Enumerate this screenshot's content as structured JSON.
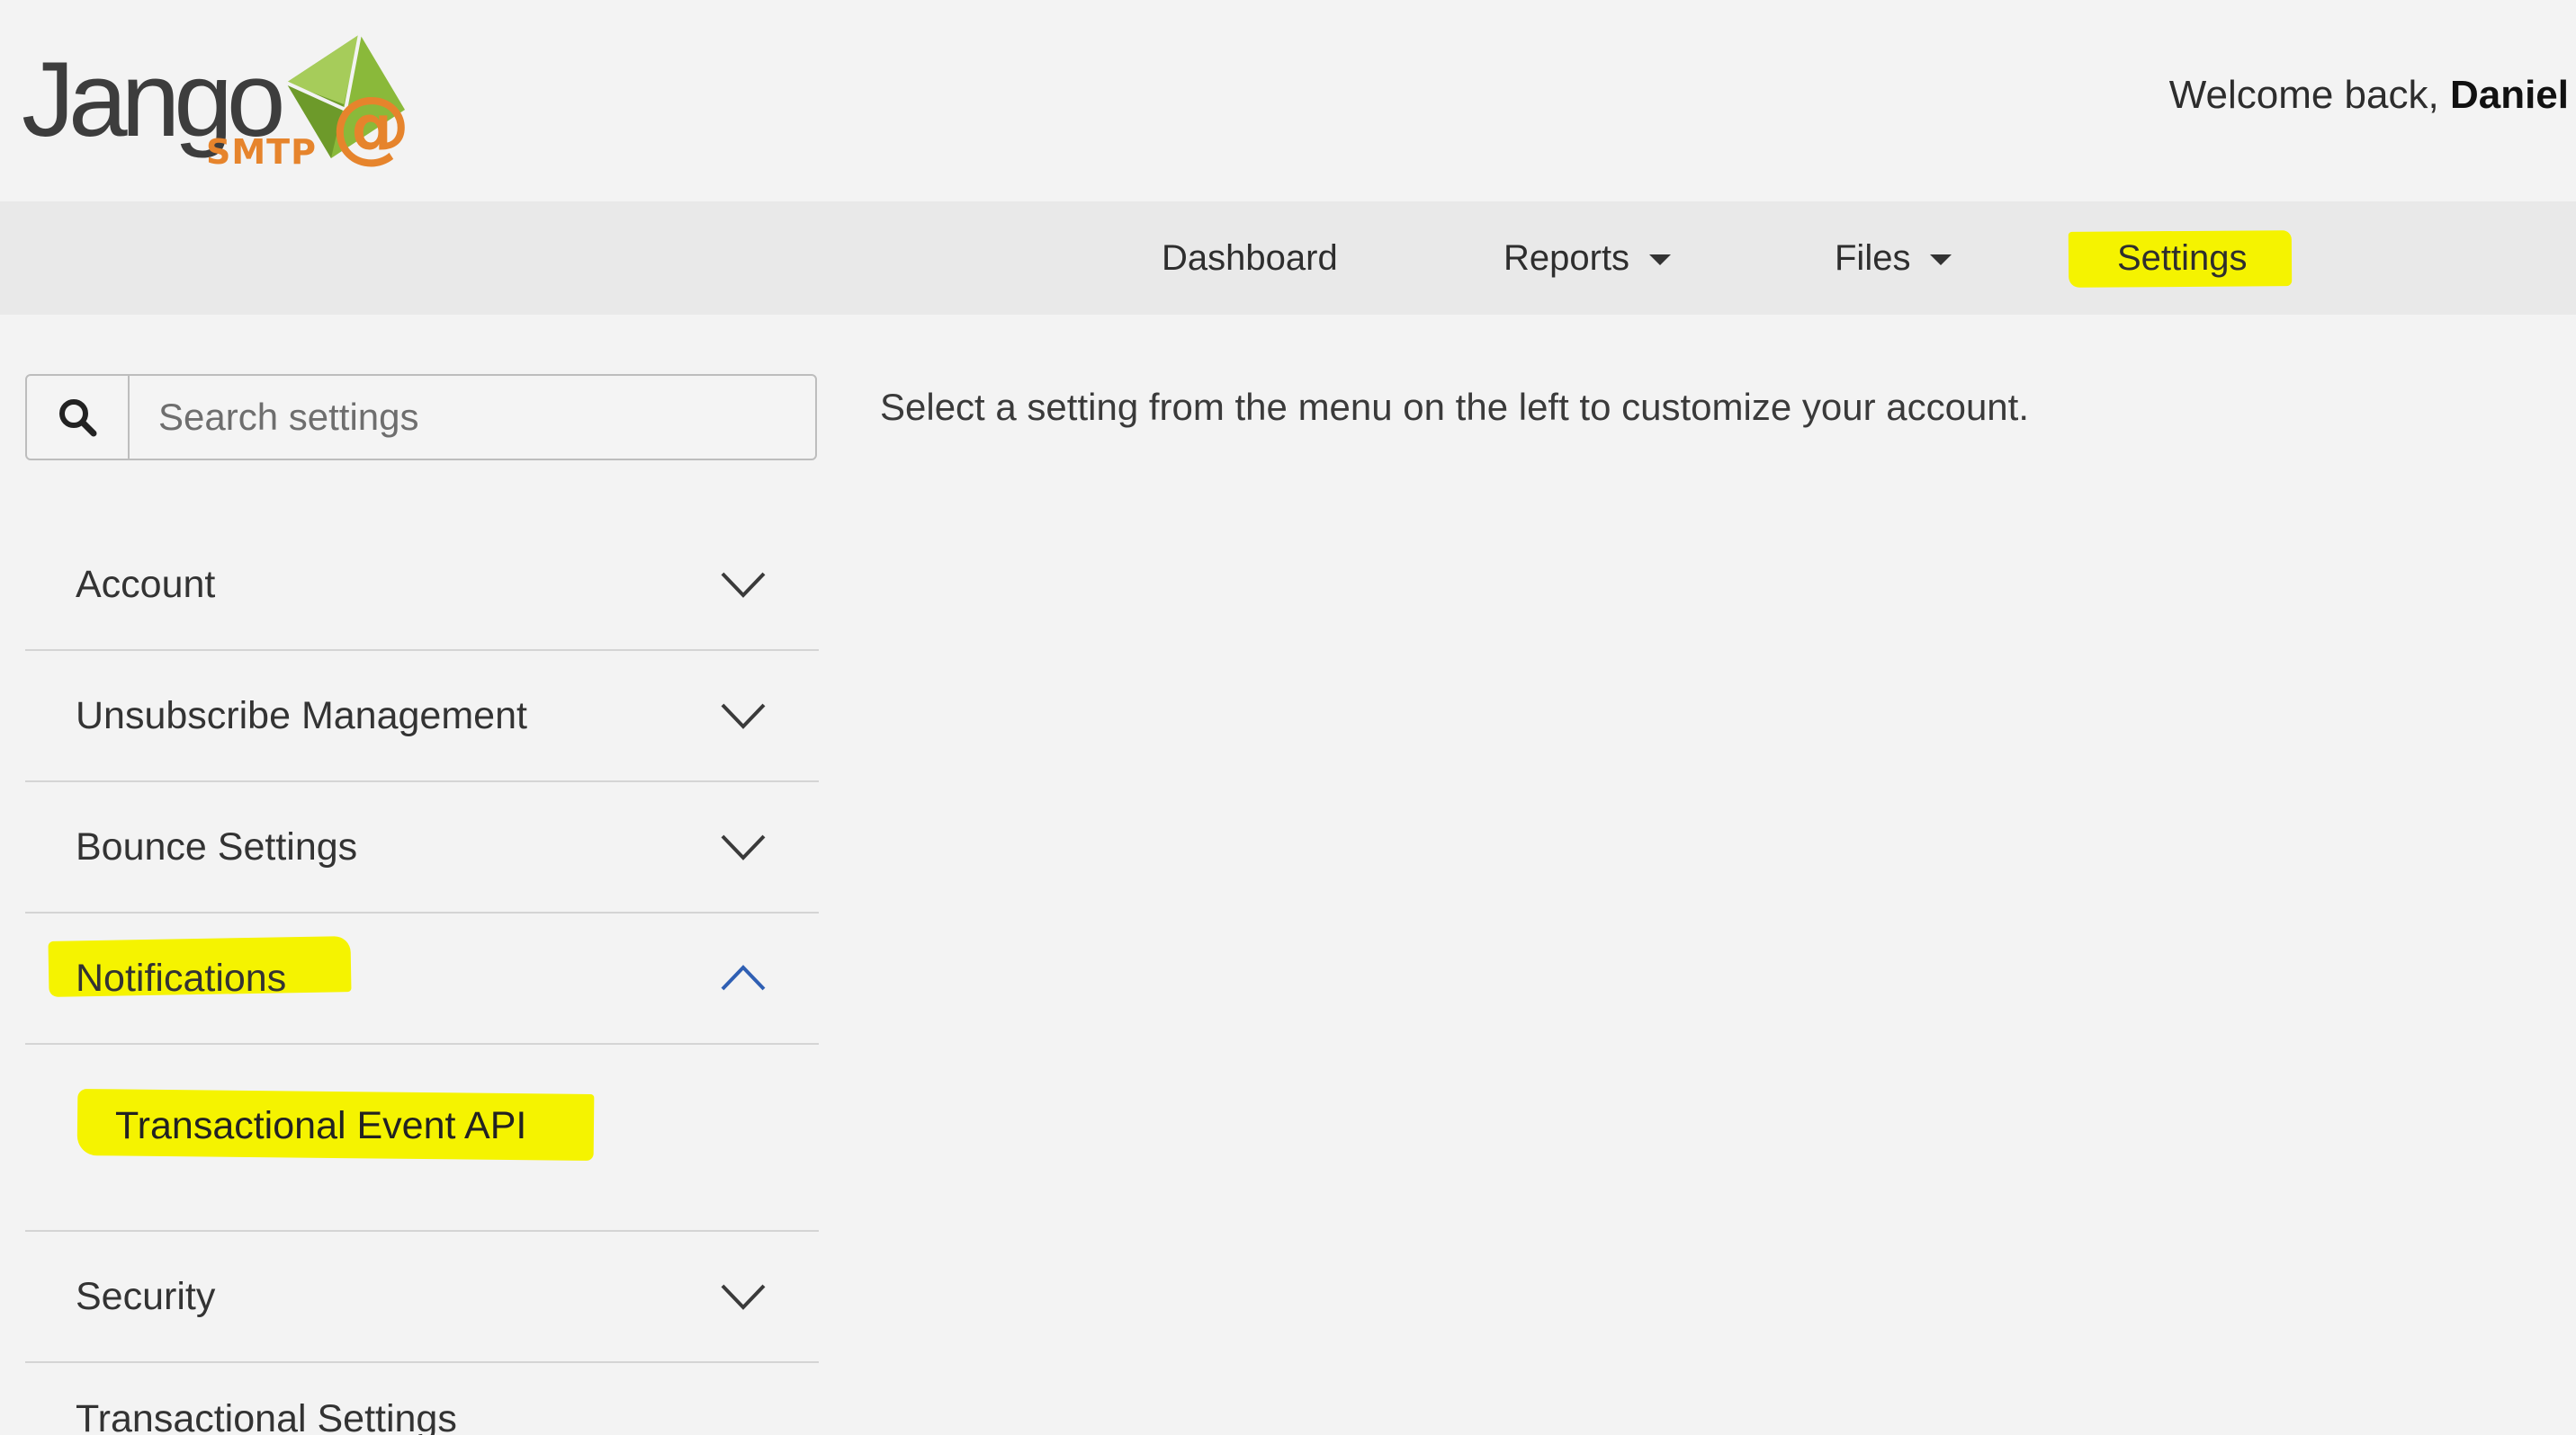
{
  "brand": {
    "name": "Jango",
    "sub": "SMTP",
    "mark_symbol": "@",
    "colors": {
      "envelope": "#8ab93a",
      "accent": "#e6842c",
      "wordmark": "#3d3d3d"
    }
  },
  "header": {
    "welcome_prefix": "Welcome back,",
    "user_name": "Daniel"
  },
  "nav": {
    "items": [
      {
        "label": "Dashboard",
        "has_dropdown": false
      },
      {
        "label": "Reports",
        "has_dropdown": true
      },
      {
        "label": "Files",
        "has_dropdown": true
      },
      {
        "label": "Settings",
        "has_dropdown": false,
        "highlighted": true
      }
    ]
  },
  "search": {
    "placeholder": "Search settings",
    "icon": "search-icon"
  },
  "menu": {
    "items": [
      {
        "label": "Account",
        "expanded": false
      },
      {
        "label": "Unsubscribe Management",
        "expanded": false
      },
      {
        "label": "Bounce Settings",
        "expanded": false
      },
      {
        "label": "Notifications",
        "expanded": true,
        "highlighted": true,
        "children": [
          {
            "label": "Transactional Event API",
            "highlighted": true
          }
        ]
      },
      {
        "label": "Security",
        "expanded": false
      },
      {
        "label": "Transactional Settings",
        "expanded": false
      }
    ]
  },
  "main": {
    "intro": "Select a setting from the menu on the left to customize your account."
  },
  "colors": {
    "highlight": "#f5f300",
    "active_chevron": "#2f5fb3",
    "chevron": "#3a3a3a",
    "nav_bg": "#e9e9e9",
    "page_bg": "#f3f3f3"
  }
}
